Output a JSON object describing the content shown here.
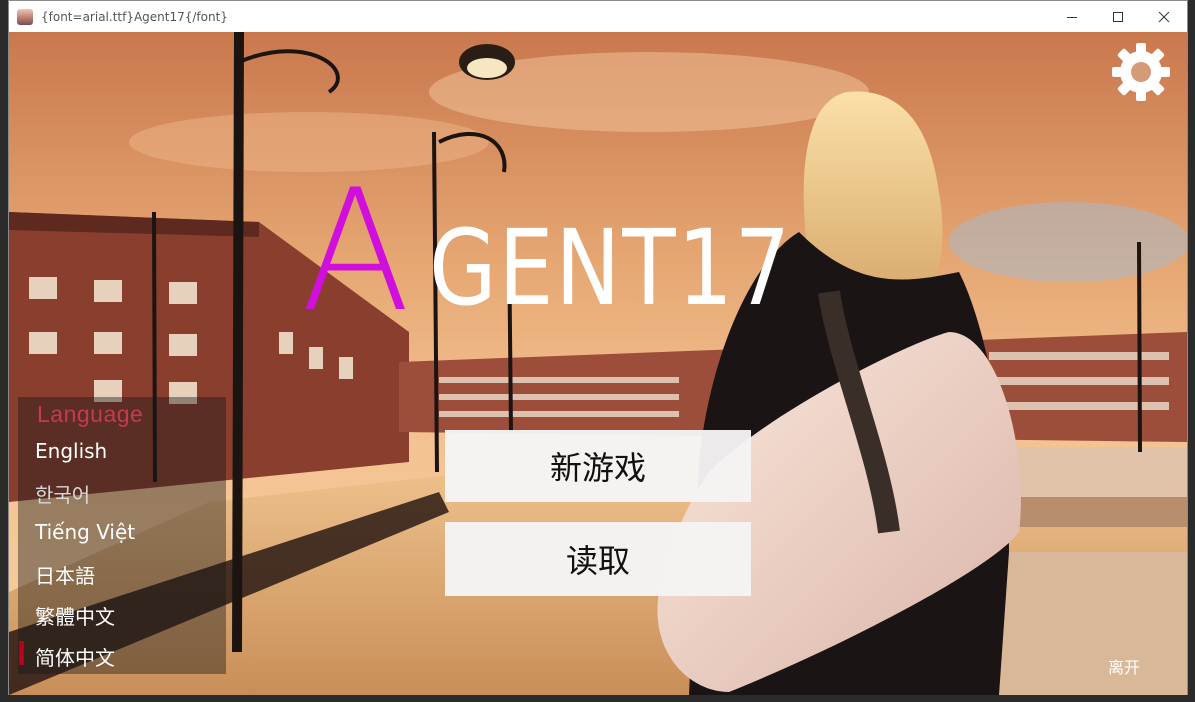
{
  "window": {
    "title": "{font=arial.ttf}Agent17{/font}",
    "controls": [
      "minimize-icon",
      "maximize-icon",
      "close-icon"
    ]
  },
  "game": {
    "logo_first_letter": "A",
    "logo_rest": "GENT17",
    "colors": {
      "logo_accent": "#d10fdc",
      "logo_main": "#ffffff",
      "language_header": "#c43a4e",
      "selected_marker": "#b8001c",
      "button_bg": "#f5f4f4"
    },
    "settings_icon": "gear-icon",
    "language_panel": {
      "title": "Language",
      "items": [
        {
          "label": "English",
          "selected": false
        },
        {
          "label": "한국어",
          "selected": false
        },
        {
          "label": "Tiếng Việt",
          "selected": false
        },
        {
          "label": "日本語",
          "selected": false
        },
        {
          "label": "繁體中文",
          "selected": false
        },
        {
          "label": "简体中文",
          "selected": true
        }
      ]
    },
    "menu": {
      "new_game": "新游戏",
      "load": "读取"
    },
    "quit_label": "离开"
  }
}
